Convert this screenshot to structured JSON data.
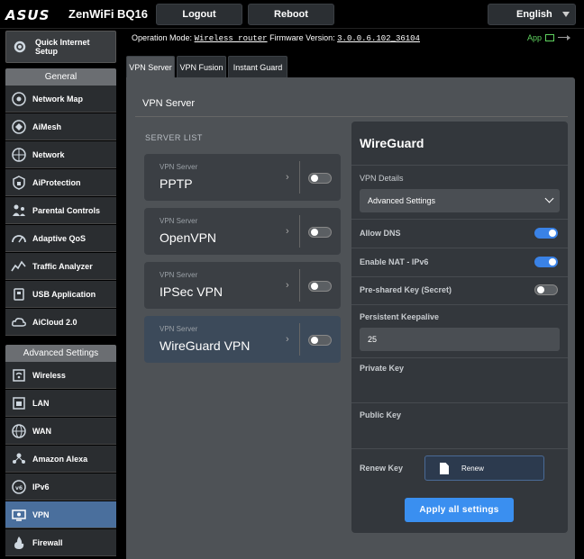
{
  "header": {
    "brand": "ASUS",
    "model": "ZenWiFi BQ16",
    "logout_label": "Logout",
    "reboot_label": "Reboot",
    "language": "English"
  },
  "status": {
    "mode_label": "Operation Mode:",
    "mode_value": "Wireless router",
    "fw_label": "Firmware Version:",
    "fw_value": "3.0.0.6.102_36104",
    "app_label": "App"
  },
  "sidebar": {
    "qis_line1": "Quick Internet",
    "qis_line2": "Setup",
    "general_label": "General",
    "general_items": [
      {
        "label": "Network Map",
        "icon": "network-map-icon"
      },
      {
        "label": "AiMesh",
        "icon": "aimesh-icon"
      },
      {
        "label": "Network",
        "icon": "network-icon"
      },
      {
        "label": "AiProtection",
        "icon": "aiprotection-icon"
      },
      {
        "label": "Parental Controls",
        "icon": "parental-controls-icon"
      },
      {
        "label": "Adaptive QoS",
        "icon": "qos-gauge-icon"
      },
      {
        "label": "Traffic Analyzer",
        "icon": "traffic-analyzer-icon"
      },
      {
        "label": "USB Application",
        "icon": "usb-icon"
      },
      {
        "label": "AiCloud 2.0",
        "icon": "cloud-icon"
      }
    ],
    "advanced_label": "Advanced Settings",
    "advanced_items": [
      {
        "label": "Wireless",
        "icon": "wireless-icon"
      },
      {
        "label": "LAN",
        "icon": "lan-icon"
      },
      {
        "label": "WAN",
        "icon": "wan-globe-icon"
      },
      {
        "label": "Amazon Alexa",
        "icon": "alexa-icon"
      },
      {
        "label": "IPv6",
        "icon": "ipv6-icon"
      },
      {
        "label": "VPN",
        "icon": "vpn-icon"
      },
      {
        "label": "Firewall",
        "icon": "firewall-icon"
      }
    ],
    "active": "VPN"
  },
  "tabs": [
    {
      "label": "VPN Server",
      "active": true
    },
    {
      "label": "VPN Fusion",
      "active": false
    },
    {
      "label": "Instant Guard",
      "active": false
    }
  ],
  "main": {
    "title": "VPN Server",
    "server_list_label": "SERVER LIST",
    "servers": [
      {
        "small": "VPN Server",
        "name": "PPTP",
        "enabled": false
      },
      {
        "small": "VPN Server",
        "name": "OpenVPN",
        "enabled": false
      },
      {
        "small": "VPN Server",
        "name": "IPSec VPN",
        "enabled": false
      },
      {
        "small": "VPN Server",
        "name": "WireGuard VPN",
        "enabled": false
      }
    ]
  },
  "wireguard": {
    "title": "WireGuard",
    "vpn_details_label": "VPN Details",
    "vpn_details_value": "Advanced Settings",
    "allow_dns_label": "Allow DNS",
    "allow_dns": true,
    "enable_nat_label": "Enable NAT - IPv6",
    "enable_nat": true,
    "psk_label": "Pre-shared Key (Secret)",
    "psk": false,
    "keepalive_label": "Persistent Keepalive",
    "keepalive_value": "25",
    "private_key_label": "Private Key",
    "public_key_label": "Public Key",
    "renew_key_label": "Renew Key",
    "renew_button": "Renew",
    "apply_button": "Apply all settings"
  },
  "colors": {
    "accent": "#3a8ff0",
    "active_nav": "#4a6f9d",
    "panel": "#4e5256",
    "card": "#33373c"
  }
}
